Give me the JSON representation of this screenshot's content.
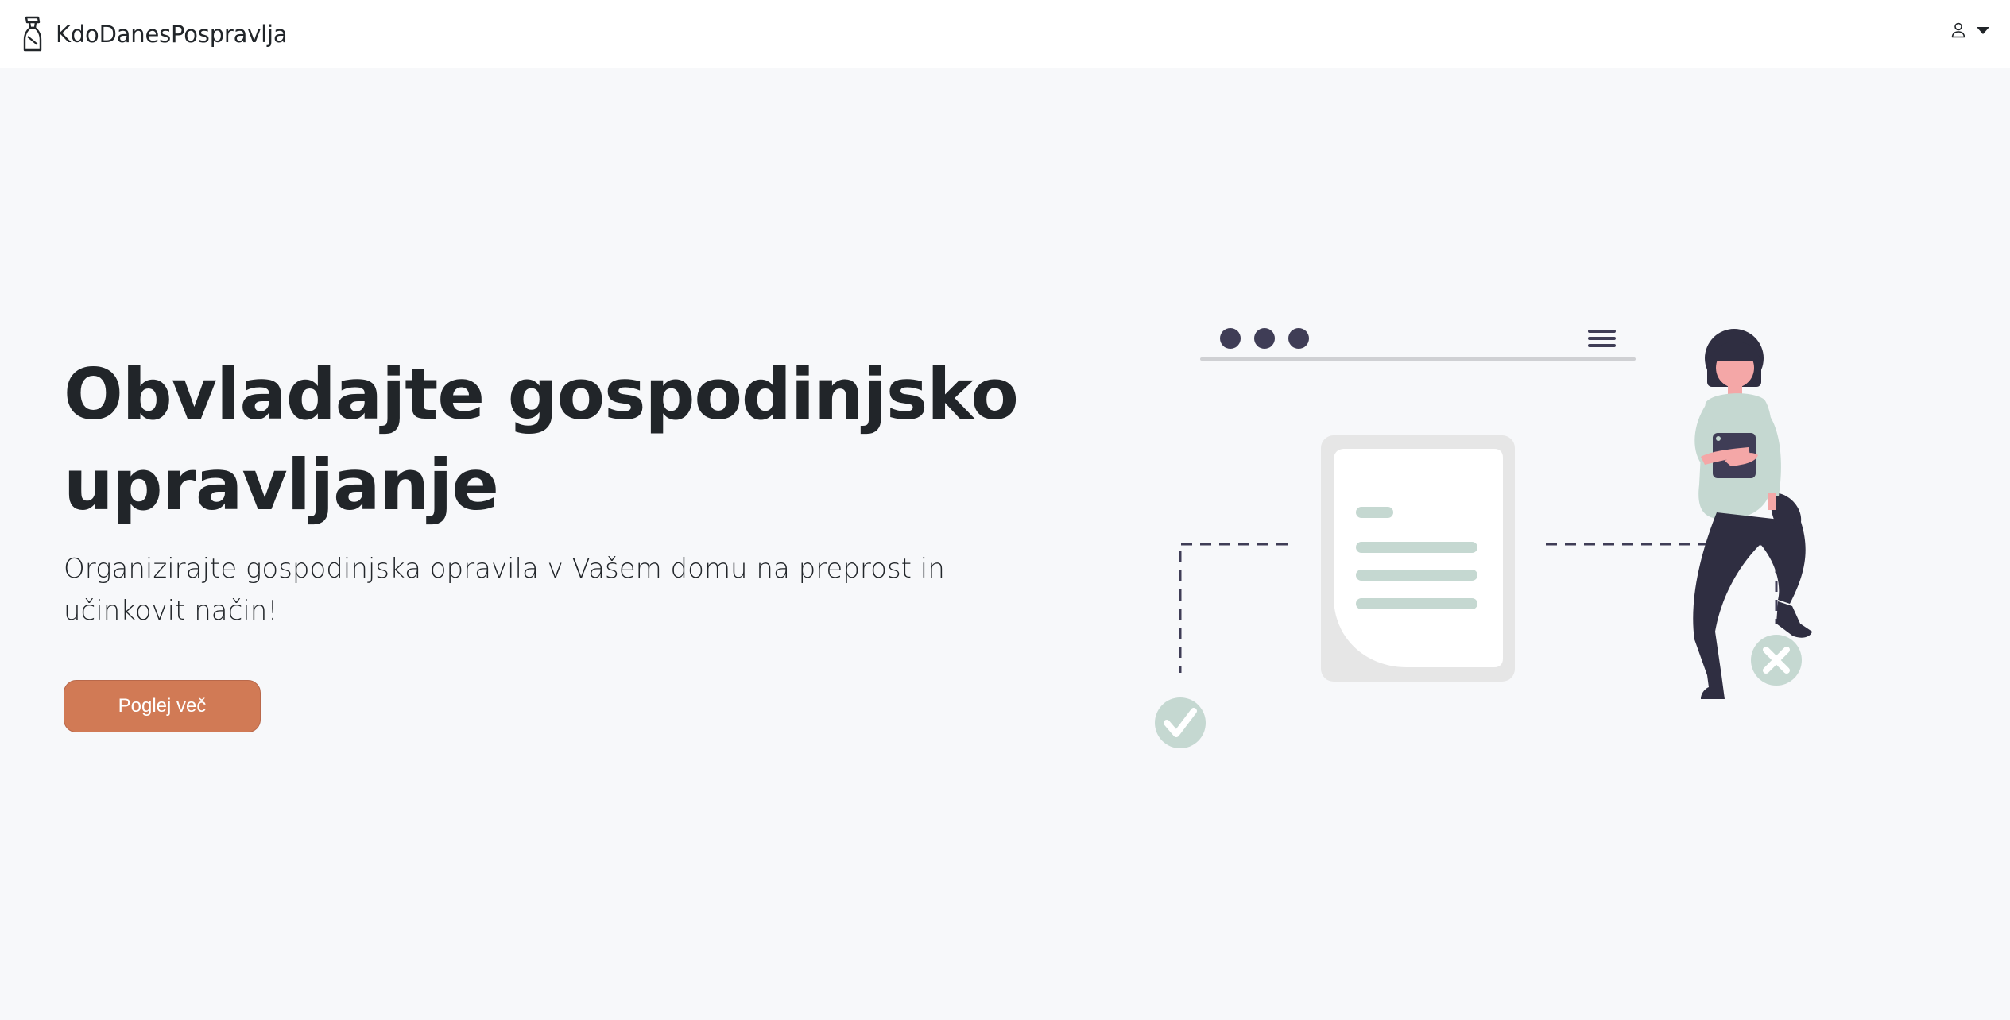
{
  "navbar": {
    "brand_name": "KdoDanesPospravlja",
    "brand_icon": "spray-bottle-icon",
    "user_icon": "person-icon"
  },
  "hero": {
    "title": "Obvladajte gospodinjsko upravljanje",
    "subtitle": "Organizirajte gospodinjska opravila v Vašem domu na preprost in učinkovit način!",
    "cta_label": "Poglej več"
  },
  "colors": {
    "accent": "#d17a55",
    "background": "#f7f8fa",
    "illustration_mint": "#c5d8d1",
    "illustration_dark": "#3f3d56"
  }
}
